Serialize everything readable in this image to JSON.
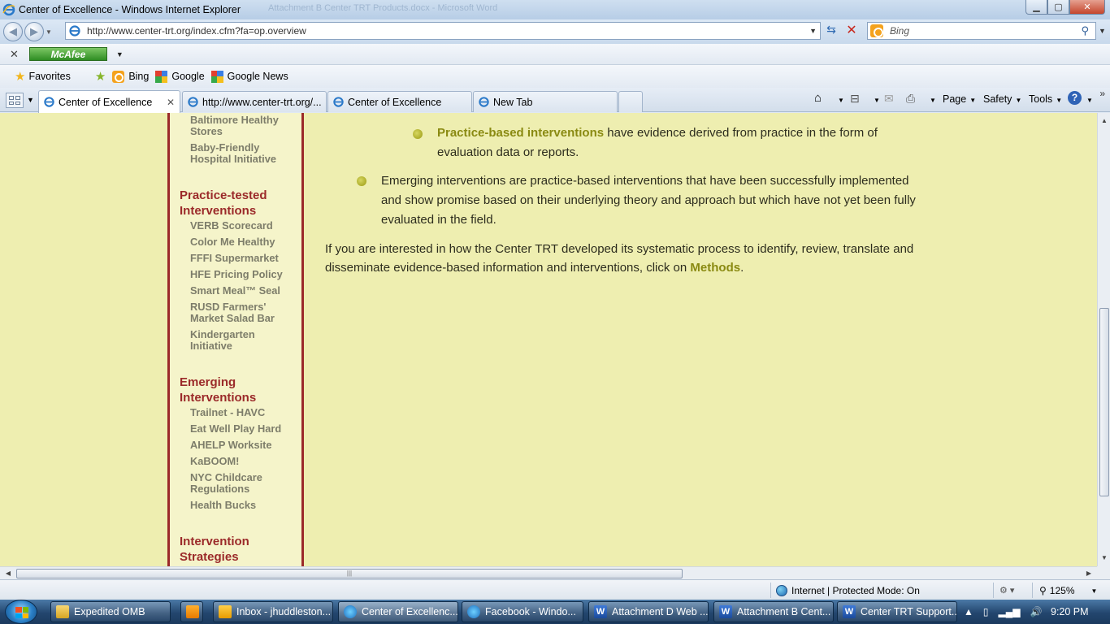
{
  "window": {
    "title": "Center of Excellence - Windows Internet Explorer",
    "ghost_text": "Attachment B Center TRT Products.docx - Microsoft Word"
  },
  "address_bar": {
    "url": "http://www.center-trt.org/index.cfm?fa=op.overview",
    "search_placeholder": "Bing"
  },
  "mcafee": {
    "label": "McAfee"
  },
  "favorites_bar": {
    "favorites_label": "Favorites",
    "items": [
      "Bing",
      "Google",
      "Google News"
    ]
  },
  "tabs": [
    {
      "label": "Center of Excellence",
      "active": true
    },
    {
      "label": "http://www.center-trt.org/...",
      "active": false
    },
    {
      "label": "Center of Excellence",
      "active": false
    },
    {
      "label": "New Tab",
      "active": false
    }
  ],
  "command_bar": {
    "page": "Page",
    "safety": "Safety",
    "tools": "Tools"
  },
  "sidebar": {
    "top_links": [
      "Baltimore Healthy Stores",
      "Baby-Friendly Hospital Initiative"
    ],
    "sections": [
      {
        "heading": "Practice-tested Interventions",
        "links": [
          "VERB Scorecard",
          "Color Me Healthy",
          "FFFI Supermarket",
          "HFE Pricing Policy",
          "Smart Meal™ Seal",
          "RUSD Farmers' Market Salad Bar",
          "Kindergarten Initiative"
        ]
      },
      {
        "heading": "Emerging Interventions",
        "links": [
          "Trailnet - HAVC",
          "Eat Well Play Hard",
          "AHELP Worksite",
          "KaBOOM!",
          "NYC Childcare Regulations",
          "Health Bucks"
        ]
      },
      {
        "heading": "Intervention Strategies",
        "links": []
      }
    ]
  },
  "main": {
    "practice_based": {
      "highlight": "Practice-based interventions",
      "text": " have evidence derived from practice in the form of evaluation data or reports."
    },
    "emerging": {
      "text": "Emerging interventions are practice-based interventions that have been successfully implemented and show promise based on their underlying theory and approach but which have not yet been fully evaluated in the field."
    },
    "methods_paragraph": {
      "text": "If you are interested in how the Center TRT developed its systematic process to identify, review, translate and disseminate evidence-based information and interventions, click on ",
      "link": "Methods",
      "end": "."
    }
  },
  "status_bar": {
    "zone": "Internet | Protected Mode: On",
    "zoom": "125%"
  },
  "taskbar": {
    "buttons": [
      {
        "label": "Expedited OMB",
        "icon": "folder-icon"
      },
      {
        "label": "Inbox - jhuddleston...",
        "icon": "outlook-icon"
      },
      {
        "label": "Center of Excellenc...",
        "icon": "ie-icon"
      },
      {
        "label": "Facebook - Windo...",
        "icon": "ie-icon"
      },
      {
        "label": "Attachment D Web ...",
        "icon": "word-icon"
      },
      {
        "label": "Attachment B Cent...",
        "icon": "word-icon"
      },
      {
        "label": "Center TRT Support...",
        "icon": "word-icon"
      }
    ],
    "clock": "9:20 PM"
  },
  "colors": {
    "content_bg": "#eeeeb0",
    "sidebar_bg": "#f5f4ca",
    "sidebar_border": "#9b2a2a",
    "heading_color": "#9b2a2a",
    "link_color": "#8a8a12"
  }
}
